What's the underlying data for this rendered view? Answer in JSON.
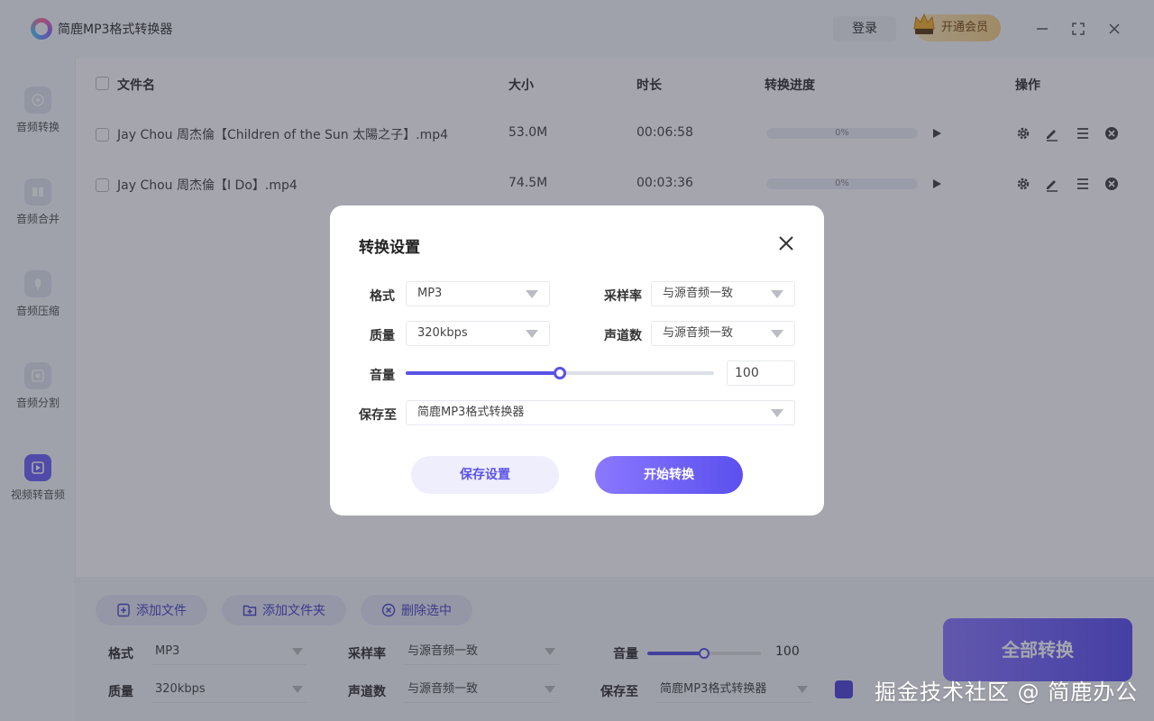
{
  "app": {
    "title": "简鹿MP3格式转换器",
    "login_label": "登录",
    "vip_label": "开通会员",
    "vip_badge": "VIP"
  },
  "sidebar": {
    "items": [
      {
        "label": "音频转换",
        "icon": "audio-convert-icon"
      },
      {
        "label": "音频合并",
        "icon": "audio-merge-icon"
      },
      {
        "label": "音频压缩",
        "icon": "audio-compress-icon"
      },
      {
        "label": "音频分割",
        "icon": "audio-split-icon"
      },
      {
        "label": "视频转音频",
        "icon": "video-to-audio-icon",
        "active": true
      }
    ]
  },
  "list": {
    "headers": {
      "name": "文件名",
      "size": "大小",
      "duration": "时长",
      "progress": "转换进度",
      "actions": "操作"
    },
    "rows": [
      {
        "name": "Jay Chou 周杰倫【Children of the Sun 太陽之子】.mp4",
        "size": "53.0M",
        "duration": "00:06:58",
        "progress": "0%"
      },
      {
        "name": "Jay Chou 周杰倫【I Do】.mp4",
        "size": "74.5M",
        "duration": "00:03:36",
        "progress": "0%"
      }
    ]
  },
  "toolbar": {
    "add_file": "添加文件",
    "add_folder": "添加文件夹",
    "delete_selected": "删除选中",
    "format_label": "格式",
    "format_value": "MP3",
    "samplerate_label": "采样率",
    "samplerate_value": "与源音频一致",
    "volume_label": "音量",
    "volume_value": "100",
    "quality_label": "质量",
    "quality_value": "320kbps",
    "channels_label": "声道数",
    "channels_value": "与源音频一致",
    "saveto_label": "保存至",
    "saveto_value": "简鹿MP3格式转换器",
    "convert_all": "全部转换"
  },
  "modal": {
    "title": "转换设置",
    "format_label": "格式",
    "format_value": "MP3",
    "samplerate_label": "采样率",
    "samplerate_value": "与源音频一致",
    "quality_label": "质量",
    "quality_value": "320kbps",
    "channels_label": "声道数",
    "channels_value": "与源音频一致",
    "volume_label": "音量",
    "volume_value": "100",
    "volume_level": 0.5,
    "saveto_label": "保存至",
    "saveto_value": "简鹿MP3格式转换器",
    "save_settings": "保存设置",
    "start_convert": "开始转换"
  },
  "watermark": "掘金技术社区 @ 简鹿办公",
  "colors": {
    "accent": "#5a52e6",
    "vip": "#f4cf86"
  }
}
